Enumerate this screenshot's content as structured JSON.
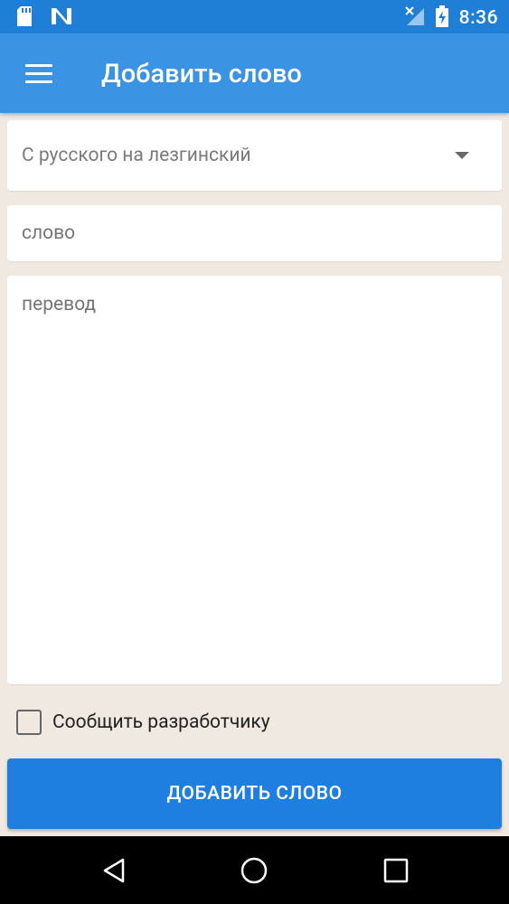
{
  "status_bar": {
    "time": "8:36",
    "left_icons": [
      "sd-card-icon",
      "n-notification-icon"
    ],
    "right_icons": [
      "no-signal-icon",
      "battery-charging-icon"
    ]
  },
  "app_bar": {
    "title": "Добавить слово",
    "menu_icon": "hamburger-menu-icon"
  },
  "form": {
    "direction_selected": "С русского на лезгинский",
    "word_placeholder": "слово",
    "translation_placeholder": "перевод",
    "notify_developer_label": "Сообщить разработчику",
    "notify_developer_checked": false,
    "submit_label": "ДОБАВИТЬ СЛОВО"
  },
  "nav_bar": {
    "buttons": [
      "back-icon",
      "home-icon",
      "recents-icon"
    ]
  },
  "colors": {
    "status_bar": "#1f7fd6",
    "app_bar": "#3b93e3",
    "button": "#1f7fe0",
    "background": "#efe9e1"
  }
}
